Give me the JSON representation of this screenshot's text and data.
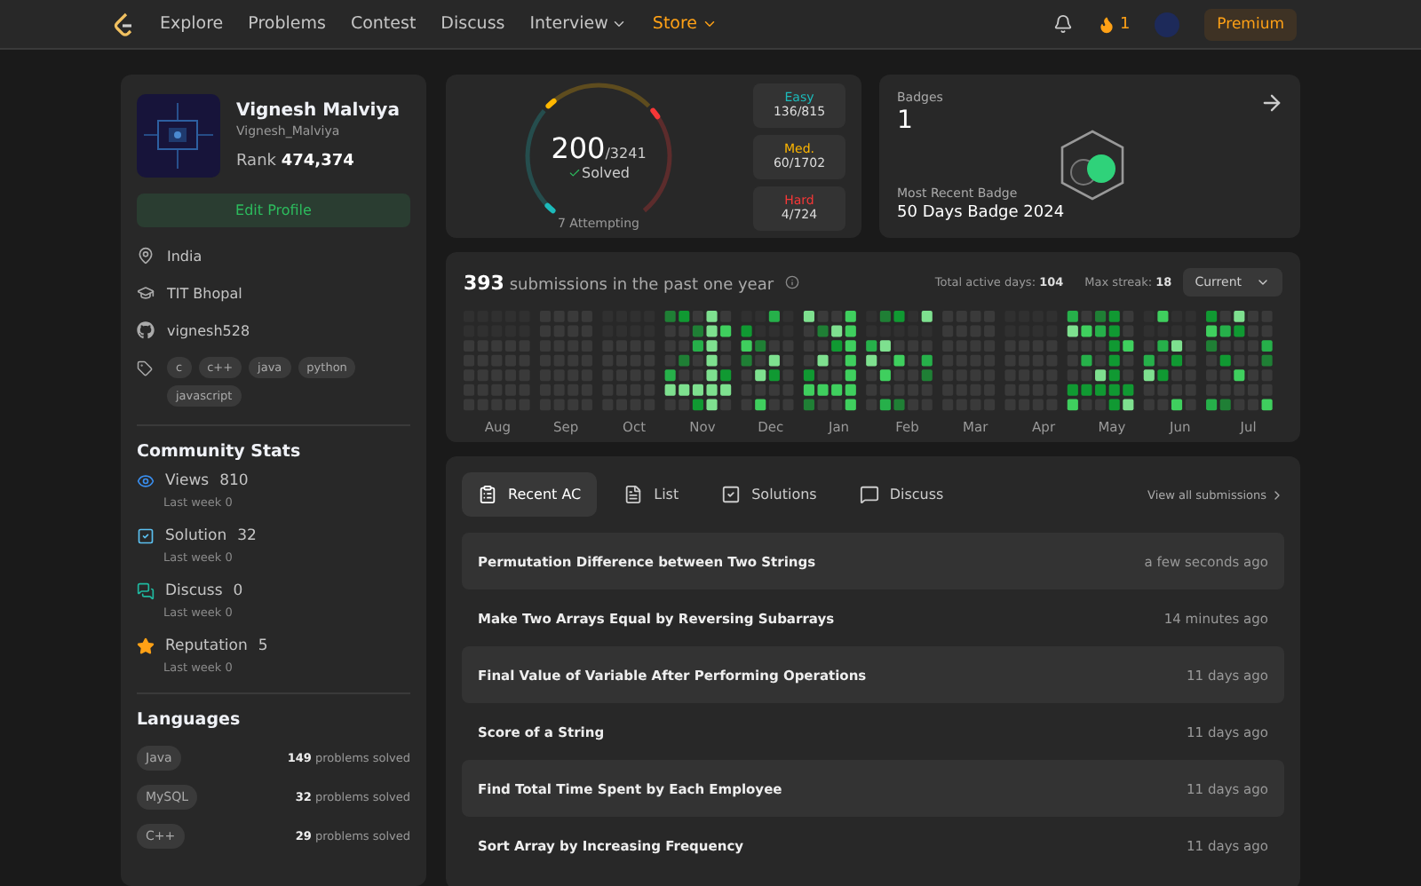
{
  "nav": {
    "links": [
      {
        "label": "Explore",
        "kind": "link"
      },
      {
        "label": "Problems",
        "kind": "link"
      },
      {
        "label": "Contest",
        "kind": "link"
      },
      {
        "label": "Discuss",
        "kind": "link"
      },
      {
        "label": "Interview",
        "kind": "dropdown"
      },
      {
        "label": "Store",
        "kind": "dropdown",
        "color": "#ffa116"
      }
    ],
    "streak": "1",
    "premium": "Premium"
  },
  "profile": {
    "name": "Vignesh Malviya",
    "username": "Vignesh_Malviya",
    "rank_label": "Rank",
    "rank": "474,374",
    "edit_button": "Edit Profile",
    "details": [
      {
        "kind": "location",
        "text": "India"
      },
      {
        "kind": "school",
        "text": "TIT Bhopal"
      },
      {
        "kind": "github",
        "text": "vignesh528"
      }
    ],
    "skills": [
      "c",
      "c++",
      "java",
      "python",
      "javascript"
    ]
  },
  "community_stats": {
    "title": "Community Stats",
    "items": [
      {
        "kind": "views",
        "label": "Views",
        "value": "810",
        "sub": "Last week 0"
      },
      {
        "kind": "solution",
        "label": "Solution",
        "value": "32",
        "sub": "Last week 0"
      },
      {
        "kind": "discuss",
        "label": "Discuss",
        "value": "0",
        "sub": "Last week 0"
      },
      {
        "kind": "reputation",
        "label": "Reputation",
        "value": "5",
        "sub": "Last week 0"
      }
    ]
  },
  "languages": {
    "title": "Languages",
    "items": [
      {
        "name": "Java",
        "count": "149",
        "suffix": "problems solved"
      },
      {
        "name": "MySQL",
        "count": "32",
        "suffix": "problems solved"
      },
      {
        "name": "C++",
        "count": "29",
        "suffix": "problems solved"
      }
    ]
  },
  "solved": {
    "count": "200",
    "total": "/3241",
    "label": "Solved",
    "attempting": "7 Attempting",
    "difficulties": [
      {
        "kind": "easy",
        "label": "Easy",
        "value": "136/815"
      },
      {
        "kind": "medium",
        "label": "Med.",
        "value": "60/1702"
      },
      {
        "kind": "hard",
        "label": "Hard",
        "value": "4/724"
      }
    ]
  },
  "badges": {
    "title": "Badges",
    "count": "1",
    "recent_label": "Most Recent Badge",
    "recent": "50 Days Badge 2024"
  },
  "activity": {
    "count": "393",
    "text": "submissions in the past one year",
    "active_label": "Total active days:",
    "active": "104",
    "streak_label": "Max streak:",
    "streak": "18",
    "period": "Current",
    "months": [
      "Aug",
      "Sep",
      "Oct",
      "Nov",
      "Dec",
      "Jan",
      "Feb",
      "Mar",
      "Apr",
      "May",
      "Jun",
      "Jul"
    ]
  },
  "submissions": {
    "tabs": [
      {
        "label": "Recent AC",
        "kind": "recent",
        "selected": true
      },
      {
        "label": "List",
        "kind": "list",
        "selected": false
      },
      {
        "label": "Solutions",
        "kind": "solutions",
        "selected": false
      },
      {
        "label": "Discuss",
        "kind": "discuss",
        "selected": false
      }
    ],
    "view_all": "View all submissions",
    "rows": [
      {
        "title": "Permutation Difference between Two Strings",
        "time": "a few seconds ago"
      },
      {
        "title": "Make Two Arrays Equal by Reversing Subarrays",
        "time": "14 minutes ago"
      },
      {
        "title": "Final Value of Variable After Performing Operations",
        "time": "11 days ago"
      },
      {
        "title": "Score of a String",
        "time": "11 days ago"
      },
      {
        "title": "Find Total Time Spent by Each Employee",
        "time": "11 days ago"
      },
      {
        "title": "Sort Array by Increasing Frequency",
        "time": "11 days ago"
      }
    ]
  }
}
